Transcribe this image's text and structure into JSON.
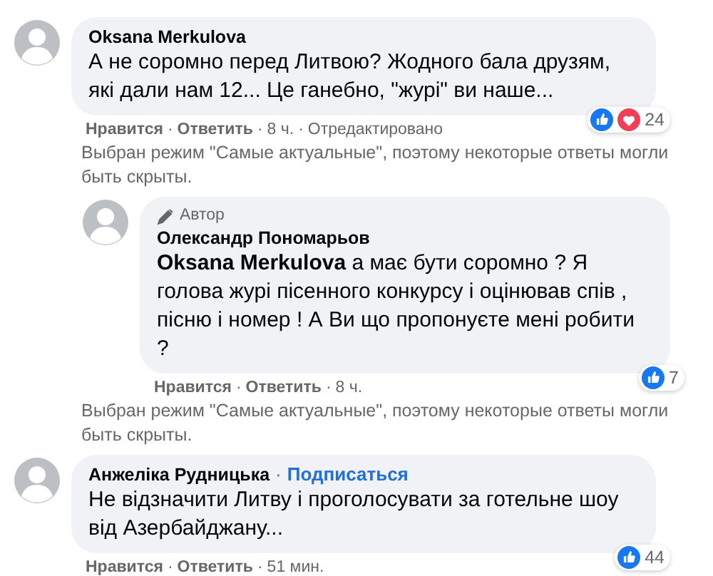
{
  "comments": [
    {
      "author": "Oksana Merkulova",
      "text_lines": [
        "А не соромно перед Литвою? Жодного бала друзям,",
        "які дали нам 12... Це ганебно, \"журі\" ви наше..."
      ],
      "reactions": {
        "like": true,
        "love": true,
        "count": "24"
      },
      "meta": [
        {
          "kind": "link",
          "text": "Нравится"
        },
        {
          "kind": "sep",
          "text": "·"
        },
        {
          "kind": "link",
          "text": "Ответить"
        },
        {
          "kind": "sep",
          "text": "·"
        },
        {
          "kind": "plain",
          "text": "8 ч."
        },
        {
          "kind": "sep",
          "text": "·"
        },
        {
          "kind": "plain",
          "text": "Отредактировано"
        }
      ],
      "notice": "Выбран режим \"Самые актуальные\", поэтому некоторые ответы могли быть скрыты.",
      "children": [
        {
          "badge": "Автор",
          "author": "Олександр Пономарьов",
          "text_lines": [
            "**Oksana Merkulova** а має бути соромно ? Я",
            "голова журі пісенного конкурсу і оцінював спів ,",
            "пісню і номер ! А Ви що пропонуєте мені робити",
            "?"
          ],
          "reactions": {
            "like": true,
            "love": false,
            "count": "7"
          },
          "meta": [
            {
              "kind": "link",
              "text": "Нравится"
            },
            {
              "kind": "sep",
              "text": "·"
            },
            {
              "kind": "link",
              "text": "Ответить"
            },
            {
              "kind": "sep",
              "text": "·"
            },
            {
              "kind": "plain",
              "text": "8 ч."
            }
          ],
          "notice": "Выбран режим \"Самые актуальные\", поэтому некоторые ответы могли быть скрыты."
        }
      ]
    },
    {
      "author": "Анжеліка Рудницька",
      "follow": {
        "separator": "·",
        "label": "Подписаться"
      },
      "text_lines": [
        "Не відзначити Литву і проголосувати за готельне шоу",
        "від Азербайджану..."
      ],
      "reactions": {
        "like": true,
        "love": false,
        "count": "44"
      },
      "meta": [
        {
          "kind": "link",
          "text": "Нравится"
        },
        {
          "kind": "sep",
          "text": "·"
        },
        {
          "kind": "link",
          "text": "Ответить"
        },
        {
          "kind": "sep",
          "text": "·"
        },
        {
          "kind": "plain",
          "text": "51 мин."
        }
      ]
    }
  ]
}
